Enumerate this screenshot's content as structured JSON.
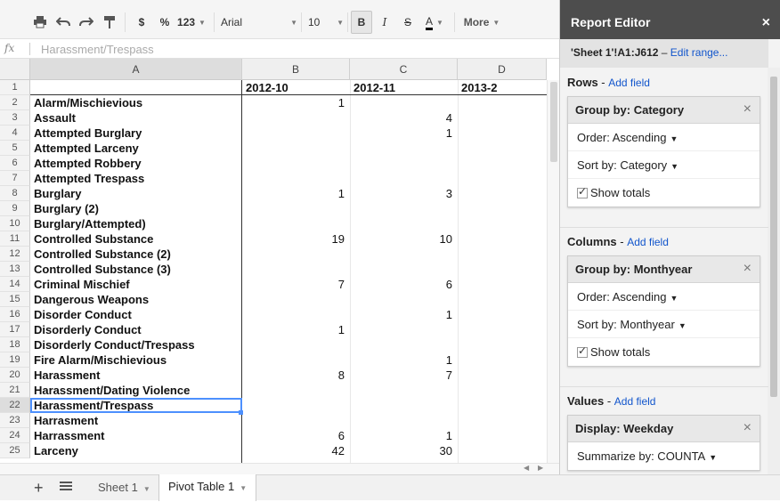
{
  "toolbar": {
    "currency": "$",
    "percent": "%",
    "format_more": "123",
    "font": "Arial",
    "font_size": "10",
    "bold": "B",
    "italic": "I",
    "strike": "S",
    "text_color": "A",
    "more": "More"
  },
  "formula_bar": {
    "fx": "fx",
    "value": "Harassment/Trespass"
  },
  "columns": [
    "A",
    "B",
    "C",
    "D"
  ],
  "grid": {
    "rows": [
      {
        "n": "1",
        "a": "",
        "b": "2012-10",
        "c": "2012-11",
        "d": "2013-2"
      },
      {
        "n": "2",
        "a": "Alarm/Mischievious",
        "b": "1",
        "c": "",
        "d": ""
      },
      {
        "n": "3",
        "a": "Assault",
        "b": "",
        "c": "4",
        "d": ""
      },
      {
        "n": "4",
        "a": "Attempted Burglary",
        "b": "",
        "c": "1",
        "d": ""
      },
      {
        "n": "5",
        "a": "Attempted Larceny",
        "b": "",
        "c": "",
        "d": ""
      },
      {
        "n": "6",
        "a": "Attempted Robbery",
        "b": "",
        "c": "",
        "d": ""
      },
      {
        "n": "7",
        "a": "Attempted Trespass",
        "b": "",
        "c": "",
        "d": ""
      },
      {
        "n": "8",
        "a": "Burglary",
        "b": "1",
        "c": "3",
        "d": ""
      },
      {
        "n": "9",
        "a": "Burglary (2)",
        "b": "",
        "c": "",
        "d": ""
      },
      {
        "n": "10",
        "a": "Burglary/Attempted)",
        "b": "",
        "c": "",
        "d": ""
      },
      {
        "n": "11",
        "a": "Controlled Substance",
        "b": "19",
        "c": "10",
        "d": ""
      },
      {
        "n": "12",
        "a": "Controlled Substance (2)",
        "b": "",
        "c": "",
        "d": ""
      },
      {
        "n": "13",
        "a": "Controlled Substance (3)",
        "b": "",
        "c": "",
        "d": ""
      },
      {
        "n": "14",
        "a": "Criminal Mischief",
        "b": "7",
        "c": "6",
        "d": ""
      },
      {
        "n": "15",
        "a": "Dangerous Weapons",
        "b": "",
        "c": "",
        "d": ""
      },
      {
        "n": "16",
        "a": "Disorder Conduct",
        "b": "",
        "c": "1",
        "d": ""
      },
      {
        "n": "17",
        "a": "Disorderly Conduct",
        "b": "1",
        "c": "",
        "d": ""
      },
      {
        "n": "18",
        "a": "Disorderly Conduct/Trespass",
        "b": "",
        "c": "",
        "d": ""
      },
      {
        "n": "19",
        "a": "Fire Alarm/Mischievious",
        "b": "",
        "c": "1",
        "d": ""
      },
      {
        "n": "20",
        "a": "Harassment",
        "b": "8",
        "c": "7",
        "d": ""
      },
      {
        "n": "21",
        "a": "Harassment/Dating Violence",
        "b": "",
        "c": "",
        "d": ""
      },
      {
        "n": "22",
        "a": "Harassment/Trespass",
        "b": "",
        "c": "",
        "d": ""
      },
      {
        "n": "23",
        "a": "Harrasment",
        "b": "",
        "c": "",
        "d": ""
      },
      {
        "n": "24",
        "a": "Harrassment",
        "b": "6",
        "c": "1",
        "d": ""
      },
      {
        "n": "25",
        "a": "Larceny",
        "b": "42",
        "c": "30",
        "d": ""
      }
    ]
  },
  "tabs": {
    "sheet1": "Sheet 1",
    "pivot": "Pivot Table 1"
  },
  "editor": {
    "title": "Report Editor",
    "close": "×",
    "range": "'Sheet 1'!A1:J612",
    "range_sep": " – ",
    "edit_range": "Edit range...",
    "rows_label": "Rows",
    "columns_label": "Columns",
    "values_label": "Values",
    "add_field": "Add field",
    "dash": " - ",
    "rows_card": {
      "head": "Group by: Category",
      "order": "Order: Ascending",
      "sort": "Sort by: Category",
      "totals": "Show totals"
    },
    "columns_card": {
      "head": "Group by: Monthyear",
      "order": "Order: Ascending",
      "sort": "Sort by: Monthyear",
      "totals": "Show totals"
    },
    "values_card": {
      "head": "Display: Weekday",
      "summarize": "Summarize by: COUNTA"
    },
    "card_close": "×"
  }
}
